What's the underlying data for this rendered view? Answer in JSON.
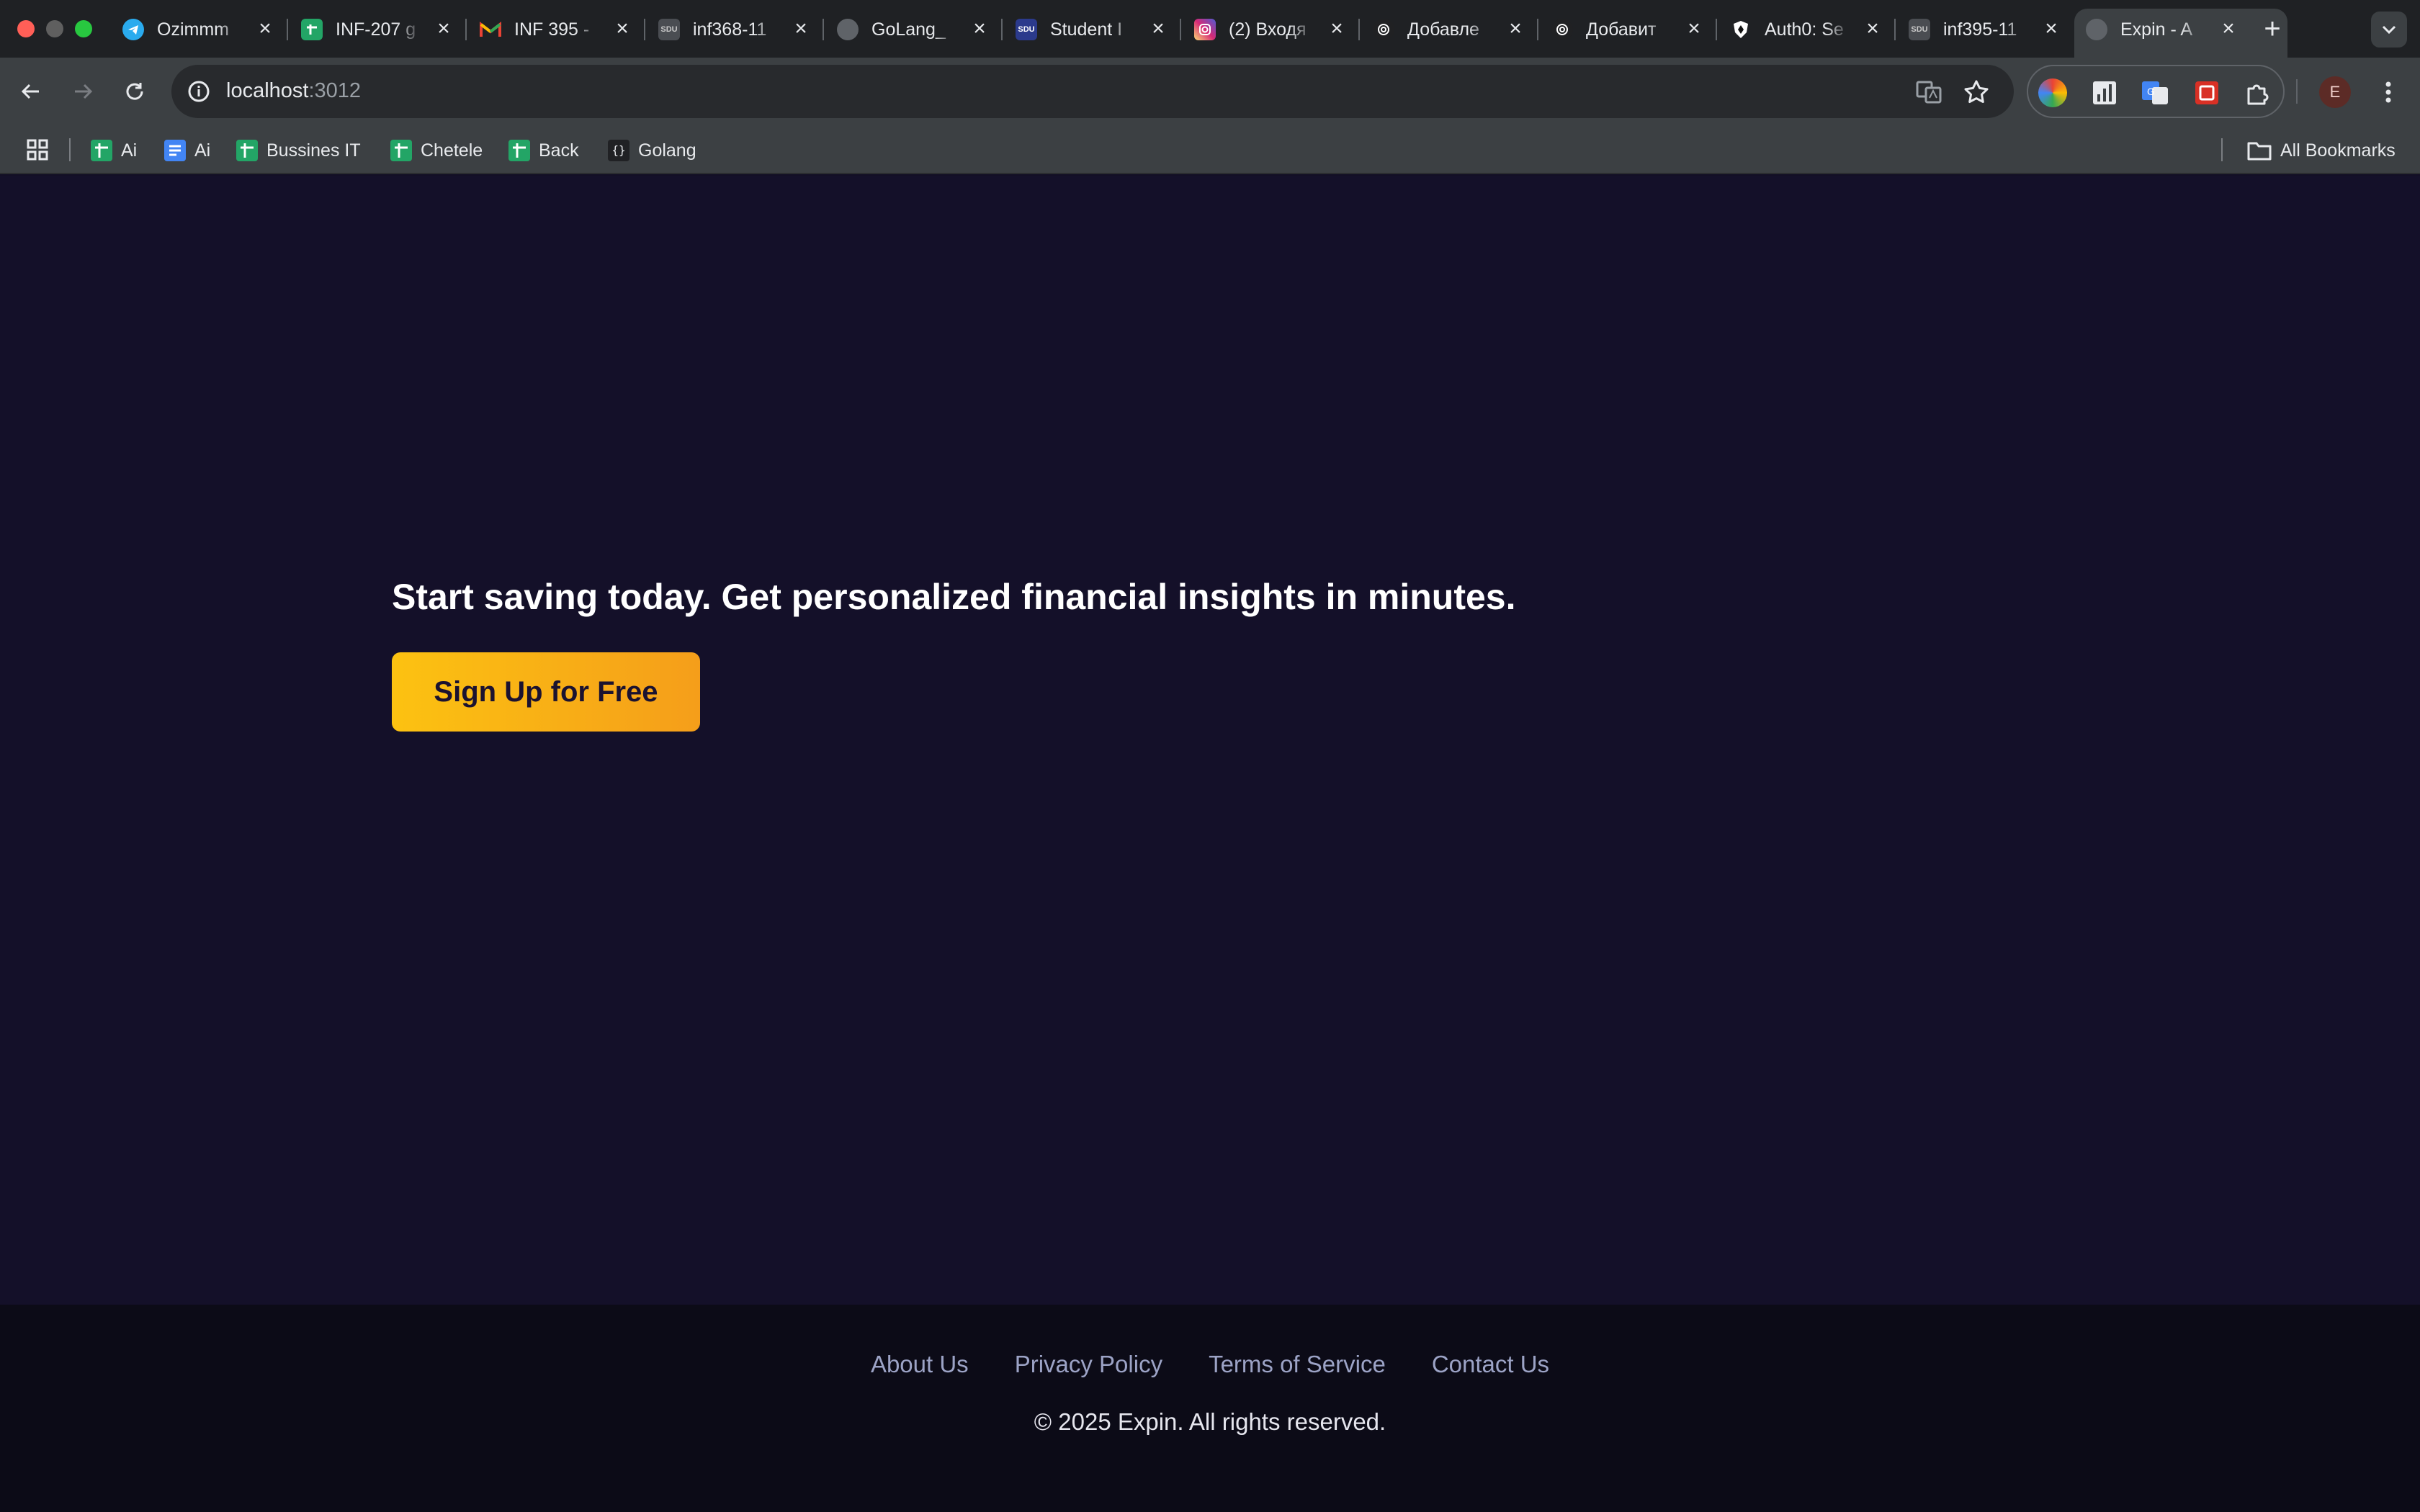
{
  "window": {
    "traffic_colors": [
      "#ff5f57",
      "#5f5f5f",
      "#28c840"
    ]
  },
  "tabs": [
    {
      "title": "Ozimmm",
      "icon": "telegram-icon",
      "color": "#2aabee"
    },
    {
      "title": "INF-207 g",
      "icon": "google-sheets-icon",
      "color": "#23a566"
    },
    {
      "title": "INF 395 -",
      "icon": "gmail-icon",
      "color": "#ea4335"
    },
    {
      "title": "inf368-11",
      "icon": "sdu-icon",
      "color": "#6b6f75"
    },
    {
      "title": "GoLang_",
      "icon": "globe-icon",
      "color": "#5f6368"
    },
    {
      "title": "Student I",
      "icon": "sdu-portal-icon",
      "color": "#2b3a8c"
    },
    {
      "title": "(2) Входя",
      "icon": "instagram-icon",
      "color": "#d62976"
    },
    {
      "title": "Добавле",
      "icon": "chatgpt-icon",
      "color": "#202123"
    },
    {
      "title": "Добавит",
      "icon": "chatgpt-icon",
      "color": "#202123"
    },
    {
      "title": "Auth0: Se",
      "icon": "auth0-icon",
      "color": "#111111"
    },
    {
      "title": "inf395-11",
      "icon": "sdu-icon",
      "color": "#6b6f75"
    },
    {
      "title": "Expin - A",
      "icon": "globe-icon",
      "color": "#5f6368",
      "active": true
    }
  ],
  "toolbar": {
    "url_host": "localhost",
    "url_port": ":3012"
  },
  "bookmarks": {
    "items": [
      {
        "label": "Ai",
        "icon": "google-sheets-icon"
      },
      {
        "label": "Ai",
        "icon": "google-docs-icon"
      },
      {
        "label": "Bussines IT",
        "icon": "google-sheets-icon"
      },
      {
        "label": "Chetele",
        "icon": "google-sheets-icon"
      },
      {
        "label": "Back",
        "icon": "google-sheets-icon"
      },
      {
        "label": "Golang",
        "icon": "code-braces-icon"
      }
    ],
    "all_label": "All Bookmarks"
  },
  "profile_initial": "E",
  "hero": {
    "headline": "Start saving today. Get personalized financial insights in minutes.",
    "cta_label": "Sign Up for Free"
  },
  "footer": {
    "links": [
      "About Us",
      "Privacy Policy",
      "Terms of Service",
      "Contact Us"
    ],
    "copyright": "© 2025 Expin. All rights reserved."
  }
}
